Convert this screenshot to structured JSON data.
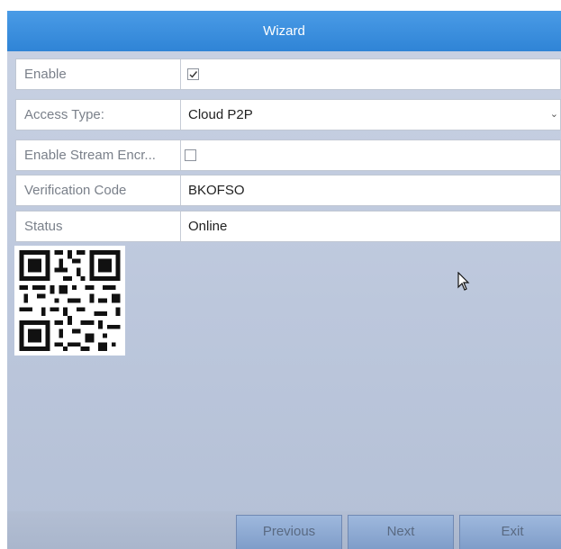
{
  "window": {
    "title": "Wizard"
  },
  "rows": {
    "enable": {
      "label": "Enable",
      "checked": true
    },
    "access_type": {
      "label": "Access Type:",
      "value": "Cloud P2P"
    },
    "stream_encryption": {
      "label": "Enable Stream Encr...",
      "checked": false
    },
    "verification_code": {
      "label": "Verification Code",
      "value": "BKOFSO"
    },
    "status": {
      "label": "Status",
      "value": "Online"
    }
  },
  "buttons": {
    "previous": "Previous",
    "next": "Next",
    "exit": "Exit"
  },
  "icons": {
    "dropdown": "chevron-down-icon",
    "cursor": "mouse-pointer-icon",
    "qr": "qr-code"
  },
  "colors": {
    "titlebar": "#3a8fdf",
    "panel": "#c3cde0",
    "button": "#8eabd4"
  }
}
